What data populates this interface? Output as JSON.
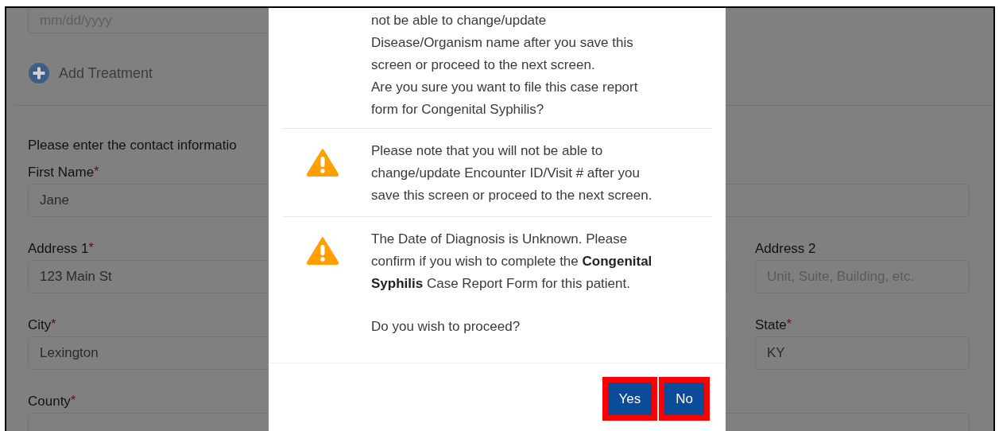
{
  "form": {
    "date_field": {
      "placeholder": "mm/dd/yyyy"
    },
    "add_treatment": "Add Treatment",
    "contact_heading": "Please enter the contact informatio",
    "rows": [
      [
        {
          "label": "First Name",
          "required_mark": "*",
          "value": "Jane"
        }
      ],
      [
        {
          "label": "Address 1",
          "required_mark": "*",
          "value": "123 Main St"
        },
        {
          "label": "Address 2",
          "placeholder": "Unit, Suite, Building, etc."
        }
      ],
      [
        {
          "label": "City",
          "required_mark": "*",
          "value": "Lexington"
        },
        {
          "label": "State",
          "required_mark": "*",
          "value": "KY"
        }
      ],
      [
        {
          "label": "County",
          "required_mark": "*"
        }
      ]
    ]
  },
  "dialog": {
    "messages": [
      {
        "kind": "continued",
        "text": "not be able to change/update\nDisease/Organism name after you save this\nscreen or proceed to the next screen.\nAre you sure you want to file this case report\nform for Congenital Syphilis?"
      },
      {
        "kind": "warning",
        "text": "Please note that you will not be able to\nchange/update Encounter ID/Visit # after you\nsave this screen or proceed to the next screen."
      },
      {
        "kind": "warning",
        "text": "The Date of Diagnosis is Unknown. Please\nconfirm if you wish to complete the **Congenital**\n**Syphilis** Case Report Form for this patient.",
        "question": "Do you wish to proceed?"
      }
    ],
    "buttons": [
      {
        "label": "Yes",
        "highlighted": true
      },
      {
        "label": "No",
        "highlighted": true
      }
    ]
  }
}
